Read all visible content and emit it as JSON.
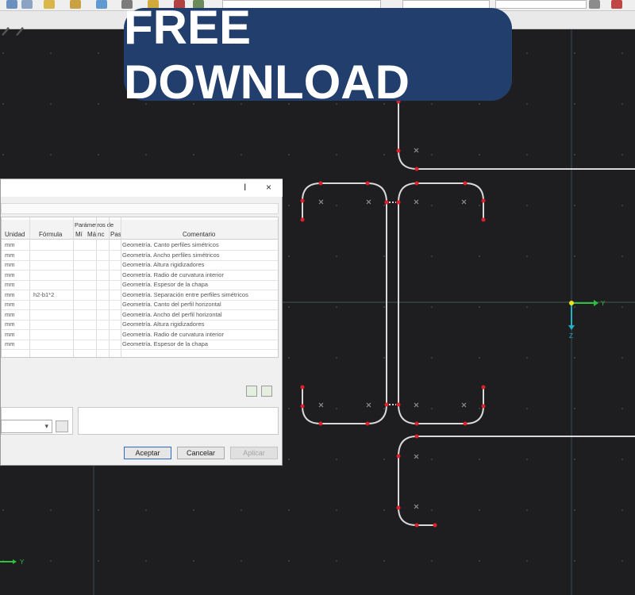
{
  "banner": {
    "text": "FREE DOWNLOAD"
  },
  "dialog": {
    "title_controls": {
      "minimize": "I",
      "close": "×"
    },
    "group_header": "Parámetros de",
    "columns": [
      "Unidad",
      "Fórmula",
      "Mí",
      "Má",
      "nc",
      "Pas",
      "Comentario"
    ],
    "rows": [
      {
        "unit": "mm",
        "formula": "",
        "comment": "Geometría. Canto perfiles simétricos"
      },
      {
        "unit": "mm",
        "formula": "",
        "comment": "Geometría. Ancho perfiles simétricos"
      },
      {
        "unit": "mm",
        "formula": "",
        "comment": "Geometría. Altura rigidizadores"
      },
      {
        "unit": "mm",
        "formula": "",
        "comment": "Geometría. Radio de curvatura interior"
      },
      {
        "unit": "mm",
        "formula": "",
        "comment": "Geometría. Espesor de la chapa"
      },
      {
        "unit": "mm",
        "formula": "h2-b1*2",
        "comment": "Geometría. Separación entre perfiles simétricos"
      },
      {
        "unit": "mm",
        "formula": "",
        "comment": "Geometría. Canto del perfil horizontal"
      },
      {
        "unit": "mm",
        "formula": "",
        "comment": "Geometría. Ancho del perfil horizontal"
      },
      {
        "unit": "mm",
        "formula": "",
        "comment": "Geometría. Altura rigidizadores"
      },
      {
        "unit": "mm",
        "formula": "",
        "comment": "Geometría. Radio de curvatura interior"
      },
      {
        "unit": "mm",
        "formula": "",
        "comment": "Geometría. Espesor de la chapa"
      }
    ],
    "buttons": {
      "accept": "Aceptar",
      "cancel": "Cancelar",
      "apply": "Aplicar"
    }
  },
  "axes": {
    "y": "Y",
    "z": "Z"
  },
  "colors": {
    "banner_bg": "#213e6d",
    "node": "#e0202a",
    "axis_y": "#2fbf3f",
    "axis_z": "#21b0c8",
    "origin": "#f0e020"
  }
}
